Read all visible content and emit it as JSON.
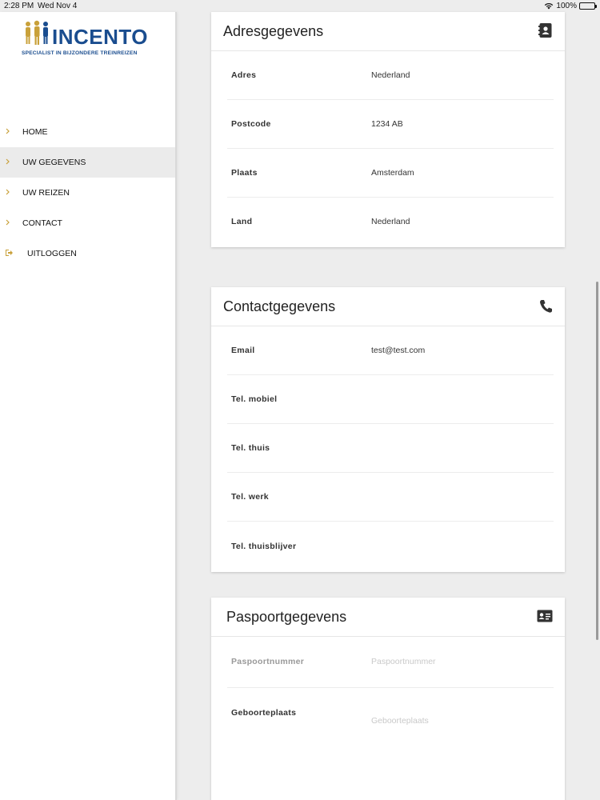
{
  "status": {
    "time": "2:28 PM",
    "date": "Wed Nov 4",
    "battery": "100%"
  },
  "logo": {
    "brand": "INCENTO",
    "tagline": "SPECIALIST IN BIJZONDERE TREINREIZEN"
  },
  "menu": [
    {
      "label": "HOME"
    },
    {
      "label": "UW GEGEVENS",
      "active": true
    },
    {
      "label": "UW REIZEN"
    },
    {
      "label": "CONTACT"
    },
    {
      "label": "UITLOGGEN"
    }
  ],
  "address": {
    "title": "Adresgegevens",
    "icon": "contact-book-icon",
    "rows": [
      {
        "label": "Adres",
        "value": "Nederland"
      },
      {
        "label": "Postcode",
        "value": "1234 AB"
      },
      {
        "label": "Plaats",
        "value": "Amsterdam"
      },
      {
        "label": "Land",
        "value": "Nederland"
      }
    ]
  },
  "contact": {
    "title": "Contactgegevens",
    "icon": "phone-icon",
    "rows": [
      {
        "label": "Email",
        "value": "test@test.com"
      },
      {
        "label": "Tel. mobiel",
        "value": ""
      },
      {
        "label": "Tel. thuis",
        "value": ""
      },
      {
        "label": "Tel. werk",
        "value": ""
      },
      {
        "label": "Tel. thuisblijver",
        "value": ""
      }
    ]
  },
  "passport": {
    "title": "Paspoortgegevens",
    "icon": "id-card-icon",
    "rows": [
      {
        "label": "Paspoortnummer",
        "value": "Paspoortnummer"
      },
      {
        "label": "Geboorteplaats",
        "value": "Geboorteplaats"
      }
    ]
  },
  "colors": {
    "accent": "#1a4d8f",
    "chevron": "#c9a13a"
  }
}
